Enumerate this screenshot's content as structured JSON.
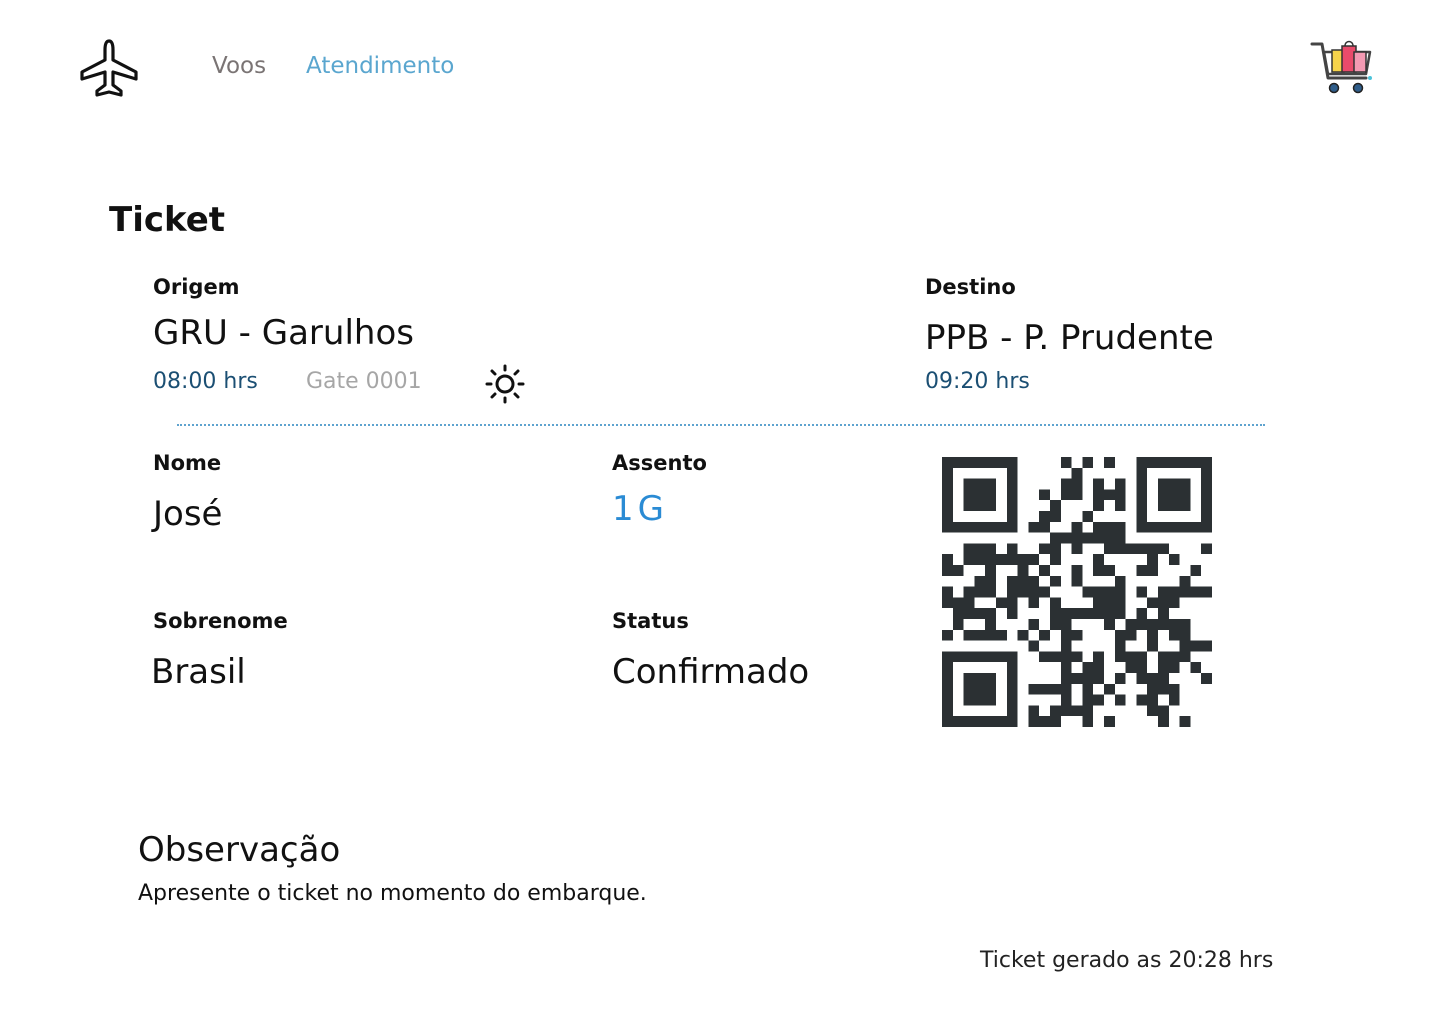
{
  "header": {
    "logo_icon": "airplane-icon",
    "nav": [
      {
        "label": "Voos",
        "color": "#7a7474"
      },
      {
        "label": "Atendimento",
        "color": "#5aa6cf"
      }
    ],
    "cart_icon": "shopping-cart-icon"
  },
  "ticket": {
    "title": "Ticket",
    "origin": {
      "label": "Origem",
      "value": "GRU - Garulhos",
      "time": "08:00 hrs",
      "gate": "Gate 0001",
      "period_icon": "sun-icon"
    },
    "destination": {
      "label": "Destino",
      "value": "PPB - P. Prudente",
      "time": "09:20 hrs"
    },
    "passenger": {
      "name_label": "Nome",
      "name": "José",
      "seat_label": "Assento",
      "seat": "1G",
      "surname_label": "Sobrenome",
      "surname": "Brasil",
      "status_label": "Status",
      "status": "Confirmado"
    },
    "qr_icon": "qr-code-icon"
  },
  "observation": {
    "title": "Observação",
    "text": "Apresente o ticket no momento do embarque."
  },
  "footer": {
    "generated": "Ticket gerado as 20:28 hrs"
  },
  "colors": {
    "accent": "#5aa6cf",
    "time": "#1b4f73",
    "seat": "#2a8bd4",
    "qr": "#2b3033"
  }
}
